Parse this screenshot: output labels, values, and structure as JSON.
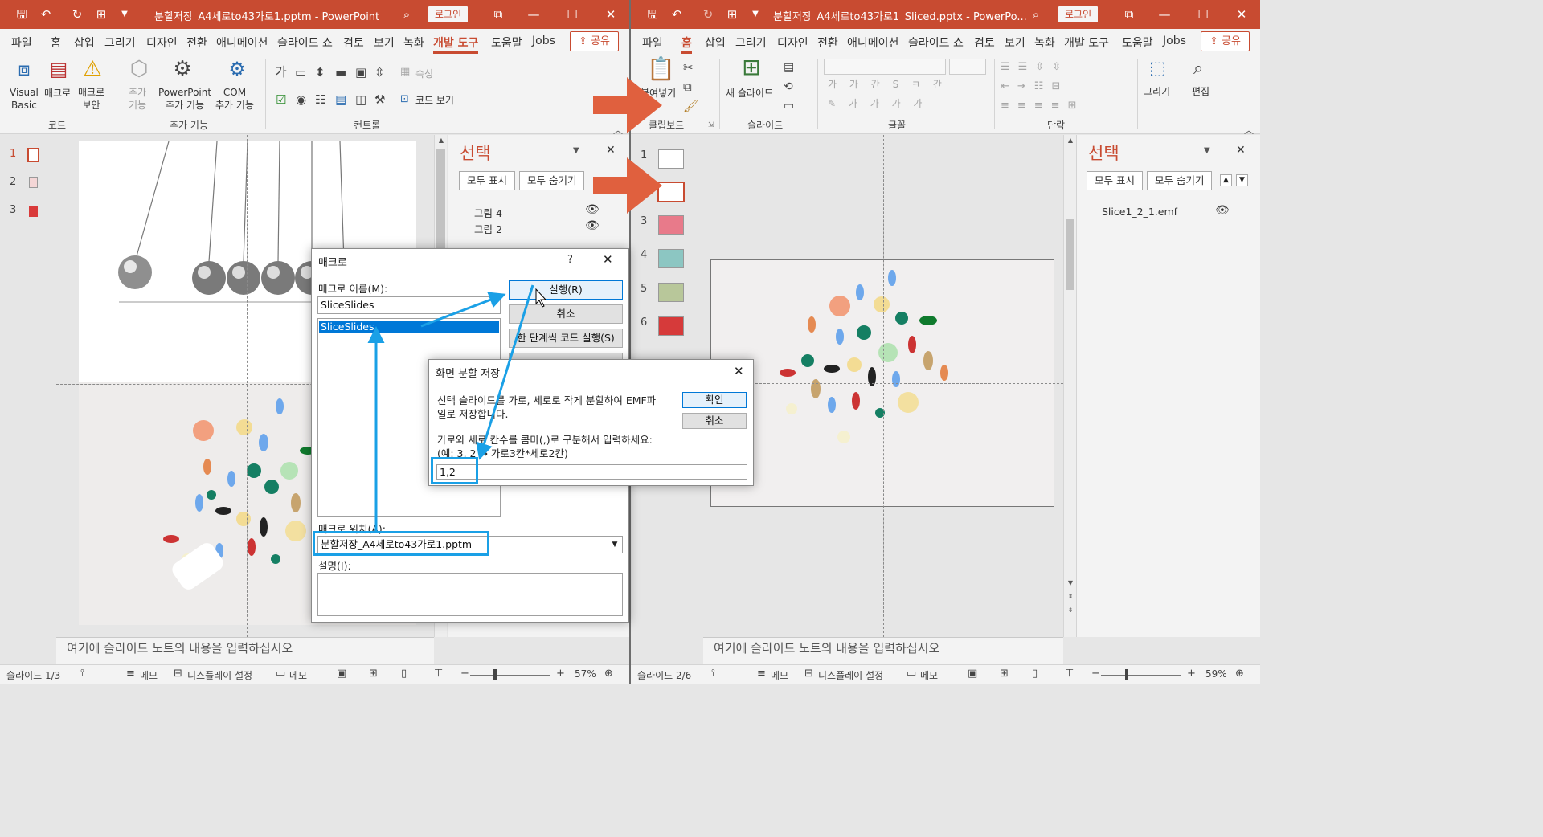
{
  "left": {
    "title": "분할저장_A4세로to43가로1.pptm - PowerPoint",
    "login_label": "로그인",
    "tabs": [
      "파일",
      "홈",
      "삽입",
      "그리기",
      "디자인",
      "전환",
      "애니메이션",
      "슬라이드 쇼",
      "검토",
      "보기",
      "녹화",
      "개발 도구",
      "도움말",
      "Jobs"
    ],
    "active_tab": "개발 도구",
    "share_label": "공유",
    "ribbon": {
      "code_group": "코드",
      "addins_group": "추가 기능",
      "controls_group": "컨트롤",
      "visual_basic": [
        "Visual",
        "Basic"
      ],
      "macro": "매크로",
      "macro_security": [
        "매크로",
        "보안"
      ],
      "addins": [
        "추가",
        "기능"
      ],
      "ppt_addins": [
        "PowerPoint",
        "추가 기능"
      ],
      "com_addins": [
        "COM",
        "추가 기능"
      ],
      "properties": "속성",
      "view_code": "코드 보기"
    },
    "slide_numbers": [
      "1",
      "2",
      "3"
    ],
    "notes_placeholder": "여기에 슬라이드 노트의 내용을 입력하십시오",
    "status": {
      "slide": "슬라이드 1/3",
      "notes": "메모",
      "display": "디스플레이 설정",
      "comments": "메모",
      "zoom": "57%"
    },
    "selection_pane": {
      "title": "선택",
      "show_all": "모두 표시",
      "hide_all": "모두 숨기기",
      "items": [
        "그림 4",
        "그림 2"
      ]
    },
    "macro_dialog": {
      "title": "매크로",
      "help": "?",
      "name_label": "매크로 이름(M):",
      "name_value": "SliceSlides",
      "list": [
        "SliceSlides"
      ],
      "run": "실행(R)",
      "cancel": "취소",
      "step": "한 단계씩 코드 실행(S)",
      "location_label": "매크로 위치(A):",
      "location_value": "분할저장_A4세로to43가로1.pptm",
      "desc_label": "설명(I):"
    },
    "split_dialog": {
      "title": "화면 분할 저장",
      "desc": [
        "선택 슬라이드를 가로, 세로로 작게 분할하여 EMF파",
        "일로 저장합니다."
      ],
      "prompt": [
        "가로와 세로 칸수를 콤마(,)로 구분해서 입력하세요:",
        "(예: 3, 2 → 가로3칸*세로2칸)"
      ],
      "input_value": "1,2",
      "ok": "확인",
      "cancel": "취소"
    }
  },
  "right": {
    "title": "분할저장_A4세로to43가로1_Sliced.pptx - PowerPo...",
    "login_label": "로그인",
    "tabs": [
      "파일",
      "홈",
      "삽입",
      "그리기",
      "디자인",
      "전환",
      "애니메이션",
      "슬라이드 쇼",
      "검토",
      "보기",
      "녹화",
      "개발 도구",
      "도움말",
      "Jobs"
    ],
    "active_tab": "홈",
    "share_label": "공유",
    "ribbon": {
      "paste": "붙여넣기",
      "clipboard_group": "클립보드",
      "new_slide": "새 슬라이드",
      "slides_group": "슬라이드",
      "font_group": "글꼴",
      "paragraph_group": "단락",
      "draw": "그리기",
      "edit": "편집"
    },
    "slide_numbers": [
      "1",
      "2",
      "3",
      "4",
      "5",
      "6"
    ],
    "notes_placeholder": "여기에 슬라이드 노트의 내용을 입력하십시오",
    "status": {
      "slide": "슬라이드 2/6",
      "notes": "메모",
      "display": "디스플레이 설정",
      "comments": "메모",
      "zoom": "59%"
    },
    "selection_pane": {
      "title": "선택",
      "show_all": "모두 표시",
      "hide_all": "모두 숨기기",
      "items": [
        "Slice1_2_1.emf"
      ]
    }
  },
  "colors": {
    "accent": "#c84b31",
    "annotation_blue": "#1aa0e6",
    "arrow_orange": "#e0603e"
  }
}
